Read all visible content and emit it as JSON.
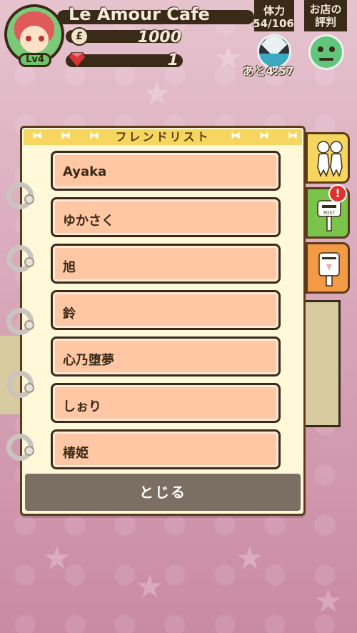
{
  "hud": {
    "cafe_name": "Le Amour Cafe",
    "level": "Lv4",
    "coins": "1000",
    "gems": "1",
    "stamina_label": "体力",
    "stamina_value": "54/106",
    "timer": "あと4:57",
    "review_label": "お店の評判",
    "coin_symbol": "£"
  },
  "friend_list": {
    "title": "フレンドリスト",
    "friends": [
      "Ayaka",
      "ゆかさく",
      "旭",
      "鈴",
      "心乃堕夢",
      "しぉり",
      "椿姫"
    ],
    "close_label": "とじる"
  },
  "side_tabs": {
    "alert_mark": "!"
  },
  "colors": {
    "row_fill": "#ffc7a4",
    "panel_bg": "#fff9d9",
    "header_bg": "#f6d65e",
    "close_bg": "#7b6e63"
  },
  "icons": {
    "avatar": "player-avatar",
    "coin": "coin-icon",
    "gem": "ruby-gem-icon",
    "stamina": "stamina-drop-icon",
    "review": "smile-face-icon",
    "friends_tab": "friends-icon",
    "mail_tab": "mailbox-icon",
    "post_tab": "postbox-icon"
  }
}
